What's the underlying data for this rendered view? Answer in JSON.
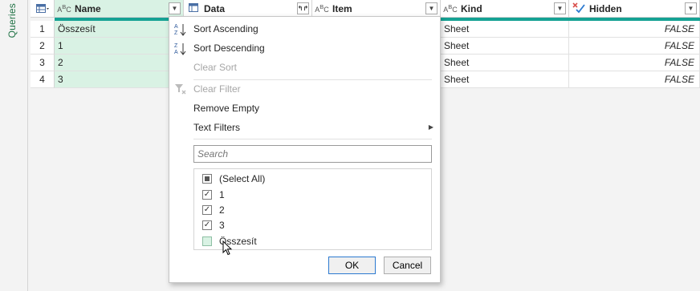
{
  "side_panel": {
    "label": "Queries"
  },
  "columns": [
    {
      "type_icon": "ABC",
      "name": "Name"
    },
    {
      "type_icon": "table",
      "name": "Data"
    },
    {
      "type_icon": "ABC",
      "name": "Item"
    },
    {
      "type_icon": "ABC",
      "name": "Kind"
    },
    {
      "type_icon": "logical",
      "name": "Hidden"
    }
  ],
  "rows": [
    {
      "num": "1",
      "name": "Összesít",
      "kind": "Sheet",
      "hidden": "FALSE"
    },
    {
      "num": "2",
      "name": "1",
      "kind": "Sheet",
      "hidden": "FALSE"
    },
    {
      "num": "3",
      "name": "2",
      "kind": "Sheet",
      "hidden": "FALSE"
    },
    {
      "num": "4",
      "name": "3",
      "kind": "Sheet",
      "hidden": "FALSE"
    }
  ],
  "menu": {
    "sort_ascending": "Sort Ascending",
    "sort_descending": "Sort Descending",
    "clear_sort": "Clear Sort",
    "clear_filter": "Clear Filter",
    "remove_empty": "Remove Empty",
    "text_filters": "Text Filters",
    "search_placeholder": "Search",
    "filter_items": [
      {
        "label": "(Select All)",
        "state": "partial"
      },
      {
        "label": "1",
        "state": "checked"
      },
      {
        "label": "2",
        "state": "checked"
      },
      {
        "label": "3",
        "state": "checked"
      },
      {
        "label": "Összesít",
        "state": "unchecked"
      }
    ],
    "ok_label": "OK",
    "cancel_label": "Cancel"
  },
  "colors": {
    "accent_teal": "#16a294",
    "selected_column_bg": "#d9f2e4",
    "side_label": "#217346"
  }
}
